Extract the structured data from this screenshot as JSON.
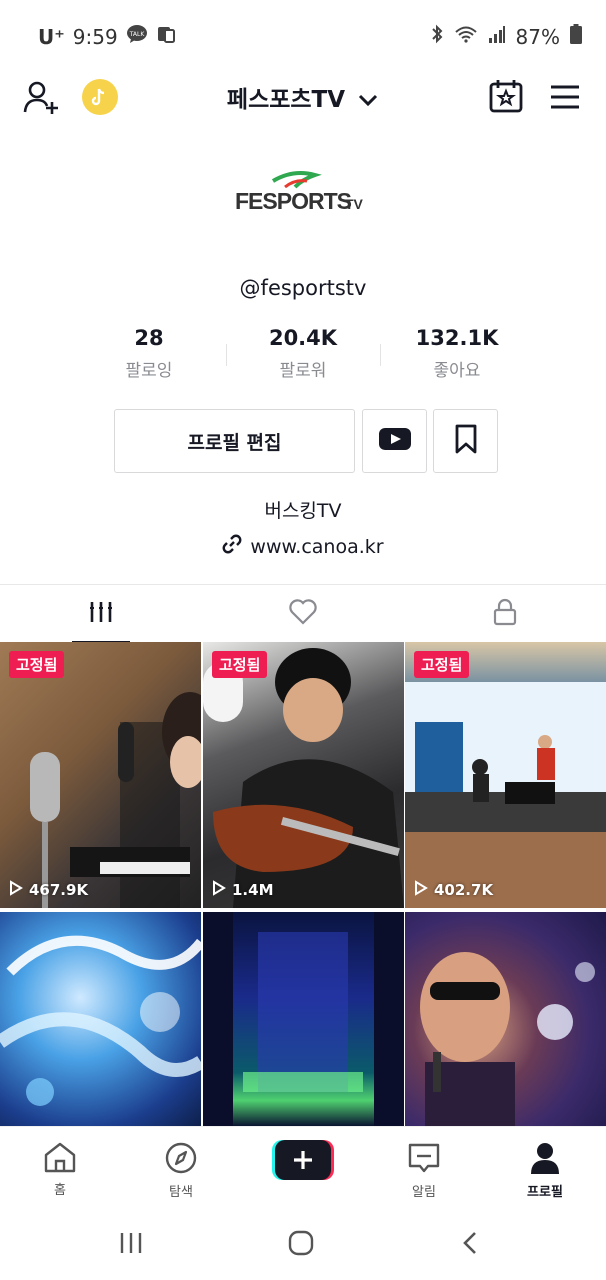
{
  "status_bar": {
    "carrier": "U⁺",
    "time": "9:59",
    "battery": "87%"
  },
  "top_nav": {
    "username_title": "페스포츠TV"
  },
  "profile": {
    "logo_text": "FESPORTS",
    "logo_suffix": "TV",
    "handle": "@fesportstv",
    "stats": [
      {
        "value": "28",
        "label": "팔로잉"
      },
      {
        "value": "20.4K",
        "label": "팔로워"
      },
      {
        "value": "132.1K",
        "label": "좋아요"
      }
    ],
    "edit_button_label": "프로필 편집",
    "bio": "버스킹TV",
    "link": "www.canoa.kr"
  },
  "videos": [
    {
      "pinned_label": "고정됨",
      "views": "467.9K"
    },
    {
      "pinned_label": "고정됨",
      "views": "1.4M"
    },
    {
      "pinned_label": "고정됨",
      "views": "402.7K"
    }
  ],
  "bottom_nav": {
    "home": "홈",
    "discover": "탐색",
    "inbox": "알림",
    "profile": "프로필"
  },
  "colors": {
    "accent_red": "#ee1d52",
    "accent_cyan": "#25f4ee",
    "text": "#161823"
  }
}
